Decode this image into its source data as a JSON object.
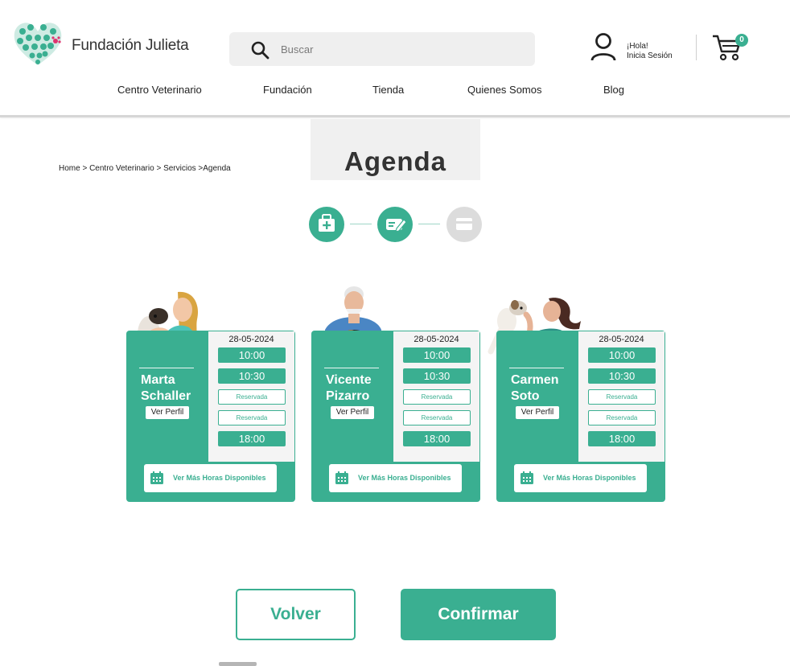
{
  "header": {
    "brand": "Fundación Julieta",
    "search_placeholder": "Buscar",
    "user_greeting": "¡Hola!",
    "user_login": "Inicia Sesión",
    "cart_count": "0",
    "nav": [
      "Centro Veterinario",
      "Fundación",
      "Tienda",
      "Quienes Somos",
      "Blog"
    ]
  },
  "page": {
    "title": "Agenda",
    "breadcrumb": "Home > Centro Veterinario > Servicios >Agenda"
  },
  "steps": [
    {
      "icon": "medical-kit-icon",
      "active": true
    },
    {
      "icon": "edit-form-icon",
      "active": true
    },
    {
      "icon": "credit-card-icon",
      "active": false
    }
  ],
  "doctors": [
    {
      "name_line1": "Marta",
      "name_line2": "Schaller",
      "profile_label": "Ver Perfil",
      "date": "28-05-2024",
      "slots": [
        {
          "label": "10:00",
          "status": "free"
        },
        {
          "label": "10:30",
          "status": "free"
        },
        {
          "label": "Reservada",
          "status": "taken"
        },
        {
          "label": "Reservada",
          "status": "taken"
        },
        {
          "label": "18:00",
          "status": "free"
        }
      ],
      "more_label": "Ver Más Horas Disponibles"
    },
    {
      "name_line1": "Vicente",
      "name_line2": "Pizarro",
      "profile_label": "Ver Perfil",
      "date": "28-05-2024",
      "slots": [
        {
          "label": "10:00",
          "status": "free"
        },
        {
          "label": "10:30",
          "status": "free"
        },
        {
          "label": "Reservada",
          "status": "taken"
        },
        {
          "label": "Reservada",
          "status": "taken"
        },
        {
          "label": "18:00",
          "status": "free"
        }
      ],
      "more_label": "Ver Más Horas Disponibles"
    },
    {
      "name_line1": "Carmen",
      "name_line2": "Soto",
      "profile_label": "Ver Perfil",
      "date": "28-05-2024",
      "slots": [
        {
          "label": "10:00",
          "status": "free"
        },
        {
          "label": "10:30",
          "status": "free"
        },
        {
          "label": "Reservada",
          "status": "taken"
        },
        {
          "label": "Reservada",
          "status": "taken"
        },
        {
          "label": "18:00",
          "status": "free"
        }
      ],
      "more_label": "Ver Más Horas Disponibles"
    }
  ],
  "actions": {
    "back_label": "Volver",
    "confirm_label": "Confirmar"
  },
  "colors": {
    "accent": "#3aaf91",
    "paw_pink": "#e0336f",
    "inactive_step": "#dcdcdc"
  }
}
